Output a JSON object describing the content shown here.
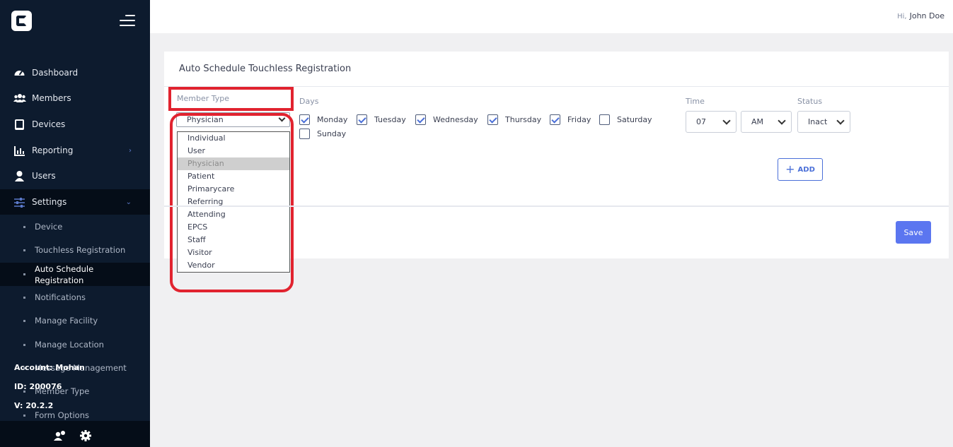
{
  "sidebar": {
    "nav": [
      {
        "label": "Dashboard",
        "icon": "dashboard-icon"
      },
      {
        "label": "Members",
        "icon": "members-icon"
      },
      {
        "label": "Devices",
        "icon": "device-icon"
      },
      {
        "label": "Reporting",
        "icon": "chart-icon",
        "chevron": "›"
      },
      {
        "label": "Users",
        "icon": "user-icon"
      },
      {
        "label": "Settings",
        "icon": "sliders-icon",
        "chevron": "⌄"
      }
    ],
    "sub_items": [
      {
        "label": "Device"
      },
      {
        "label": "Touchless Registration"
      },
      {
        "label": "Auto Schedule Registration"
      },
      {
        "label": "Notifications"
      },
      {
        "label": "Manage Facility"
      },
      {
        "label": "Manage Location"
      },
      {
        "label": "Message Management"
      },
      {
        "label": "Member Type"
      },
      {
        "label": "Form Options"
      }
    ],
    "account": {
      "account_label": "Account: Mohan",
      "id_label": "ID: 200076",
      "version_label": "V: 20.2.2"
    }
  },
  "header": {
    "greeting": "Hi,",
    "user_name": "John Doe"
  },
  "card": {
    "title": "Auto Schedule Touchless Registration",
    "member_type_label": "Member Type",
    "member_type_value": "Physician",
    "member_type_options": [
      "Individual",
      "User",
      "Physician",
      "Patient",
      "Primarycare",
      "Referring",
      "Attending",
      "EPCS",
      "Staff",
      "Visitor",
      "Vendor"
    ],
    "days_label": "Days",
    "days": [
      {
        "label": "Monday",
        "checked": true
      },
      {
        "label": "Tuesday",
        "checked": true
      },
      {
        "label": "Wednesday",
        "checked": true
      },
      {
        "label": "Thursday",
        "checked": true
      },
      {
        "label": "Friday",
        "checked": true
      },
      {
        "label": "Saturday",
        "checked": false
      },
      {
        "label": "Sunday",
        "checked": false
      }
    ],
    "time_label": "Time",
    "hour_value": "07",
    "ampm_value": "AM",
    "status_label": "Status",
    "status_value": "Inact",
    "add_label": "ADD",
    "save_label": "Save"
  },
  "colors": {
    "sidebar_bg": "#0d1b2e",
    "accent": "#5b76f0",
    "highlight": "#e1232f"
  }
}
